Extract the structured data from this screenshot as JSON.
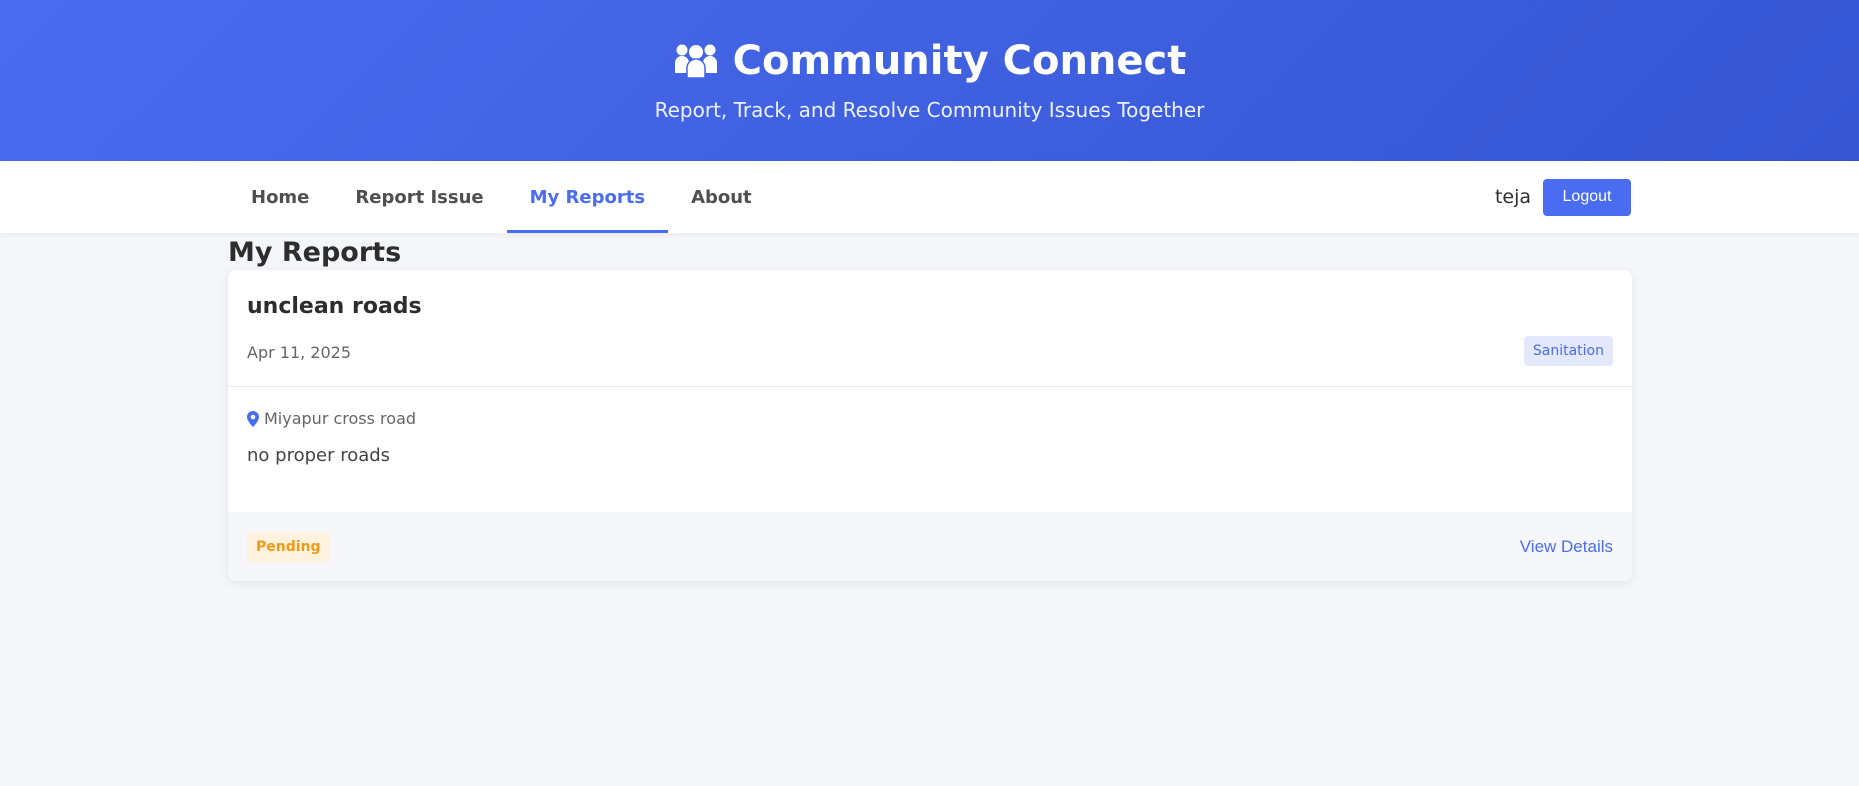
{
  "header": {
    "title": "Community Connect",
    "subtitle": "Report, Track, and Resolve Community Issues Together",
    "logo_icon": "users-icon"
  },
  "nav": {
    "items": [
      {
        "label": "Home",
        "active": false
      },
      {
        "label": "Report Issue",
        "active": false
      },
      {
        "label": "My Reports",
        "active": true
      },
      {
        "label": "About",
        "active": false
      }
    ],
    "username": "teja",
    "logout_label": "Logout"
  },
  "page": {
    "title": "My Reports"
  },
  "reports": [
    {
      "title": "unclean roads",
      "date": "Apr 11, 2025",
      "category": "Sanitation",
      "location": "Miyapur cross road",
      "description": "no proper roads",
      "status": "Pending",
      "action_label": "View Details"
    }
  ],
  "colors": {
    "primary": "#4a6cf0",
    "pending": "#f29a13",
    "background": "#f4f6fa"
  }
}
